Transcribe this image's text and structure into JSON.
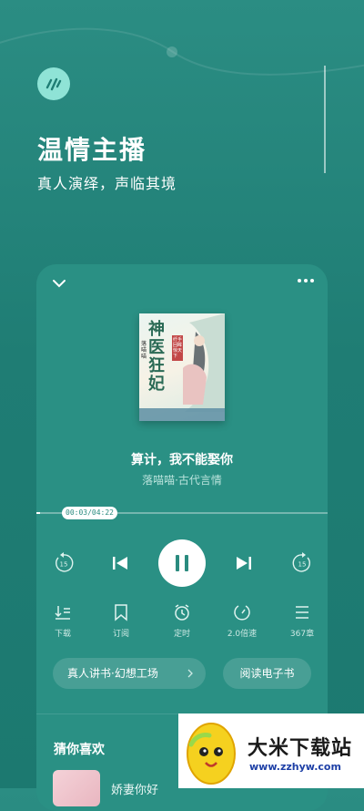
{
  "hero": {
    "title": "温情主播",
    "subtitle": "真人演绎，声临其境"
  },
  "player": {
    "book_title": "算计，我不能娶你",
    "author_genre": "落喵喵·古代言情",
    "time": "00:03/04:22",
    "progress": 0.012,
    "skip_back_seconds": "15",
    "skip_forward_seconds": "15",
    "cover_title": "神医狂妃",
    "cover_author": "落喵喵",
    "cover_tagline": "纤手回眸惊天下"
  },
  "tools": [
    {
      "icon": "download-icon",
      "label": "下载"
    },
    {
      "icon": "bookmark-icon",
      "label": "订阅"
    },
    {
      "icon": "alarm-clock-icon",
      "label": "定时"
    },
    {
      "icon": "speed-icon",
      "label": "2.0倍速"
    },
    {
      "icon": "list-icon",
      "label": "367章"
    }
  ],
  "actions": {
    "studio_label": "真人讲书·幻想工场",
    "ebook_label": "阅读电子书"
  },
  "recommend": {
    "title": "猜你喜欢",
    "first_item": "娇妻你好"
  },
  "watermark": {
    "name": "大米下载站",
    "url": "www.zzhyw.com"
  },
  "colors": {
    "background": "#1f7d74",
    "card": "#2a9084",
    "accent_light": "#8fe3d6"
  }
}
